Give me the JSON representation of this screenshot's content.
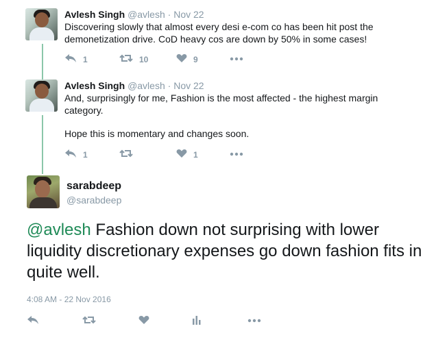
{
  "thread": [
    {
      "name": "Avlesh Singh",
      "handle": "@avlesh",
      "separator": "·",
      "date": "Nov 22",
      "text_lines": [
        "Discovering slowly that almost every desi e-com co has been hit post the",
        "demonetization drive. CoD heavy cos are down by 50% in some cases!"
      ],
      "reply_count": "1",
      "retweet_count": "10",
      "like_count": "9"
    },
    {
      "name": "Avlesh Singh",
      "handle": "@avlesh",
      "separator": "·",
      "date": "Nov 22",
      "text_lines": [
        "And, surprisingly for me, Fashion is the most affected - the highest margin",
        "category.",
        "",
        "Hope this is momentary and changes soon."
      ],
      "reply_count": "1",
      "retweet_count": "",
      "like_count": "1"
    }
  ],
  "main": {
    "name": "sarabdeep",
    "handle": "@sarabdeep",
    "mention": "@avlesh",
    "text": " Fashion down not surprising with lower liquidity discretionary expenses go down fashion fits in quite well.",
    "timestamp": "4:08 AM - 22 Nov 2016"
  },
  "colors": {
    "accent": "#1f8a57",
    "thread_line": "#8bc6a9",
    "muted": "#8899a6"
  },
  "icons": [
    "reply-icon",
    "retweet-icon",
    "like-icon",
    "more-icon",
    "analytics-icon"
  ]
}
